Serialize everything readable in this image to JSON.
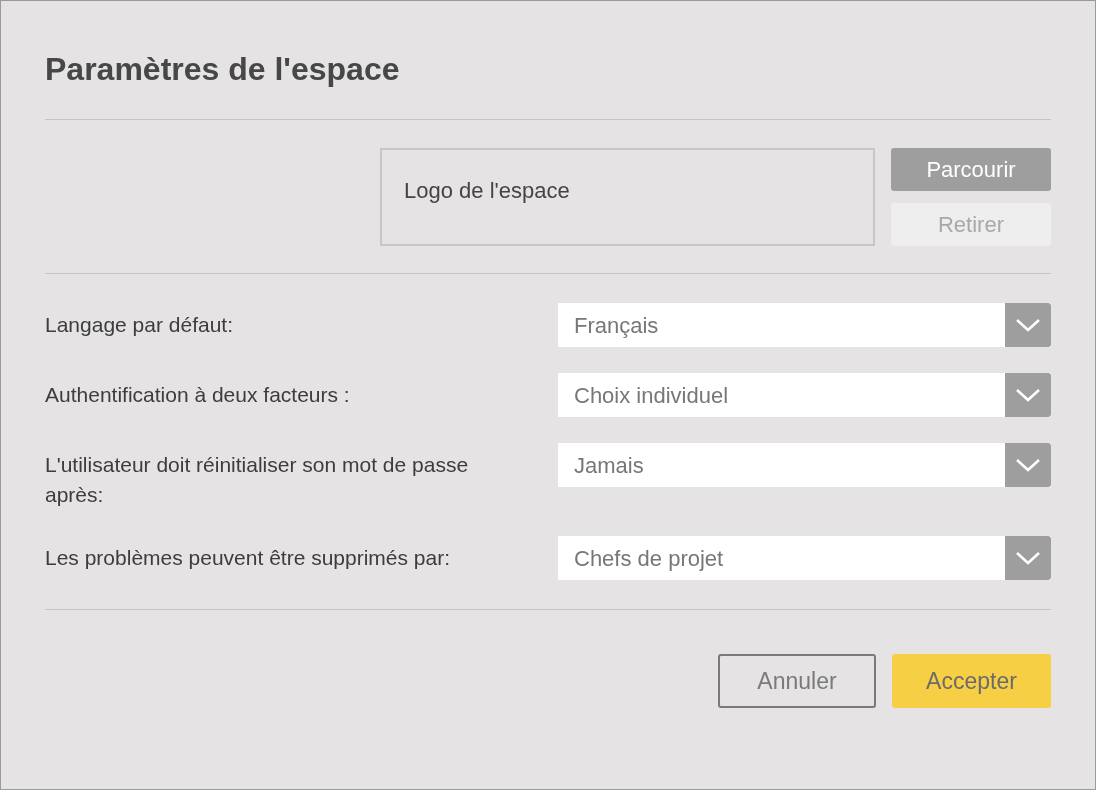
{
  "dialog": {
    "title": "Paramètres de l'espace"
  },
  "logo": {
    "label": "Logo de l'espace",
    "buttons": [
      {
        "label": "Parcourir",
        "disabled": false
      },
      {
        "label": "Retirer",
        "disabled": true
      }
    ]
  },
  "settings": [
    {
      "label": "Langage par défaut:",
      "value": "Français"
    },
    {
      "label": "Authentification à deux facteurs :",
      "value": "Choix individuel"
    },
    {
      "label": "L'utilisateur doit réinitialiser son mot de passe après:",
      "value": "Jamais"
    },
    {
      "label": "Les problèmes peuvent être supprimés par:",
      "value": "Chefs de projet"
    }
  ],
  "footer": {
    "buttons": [
      {
        "label": "Annuler",
        "kind": "secondary"
      },
      {
        "label": "Accepter",
        "kind": "primary"
      }
    ]
  }
}
